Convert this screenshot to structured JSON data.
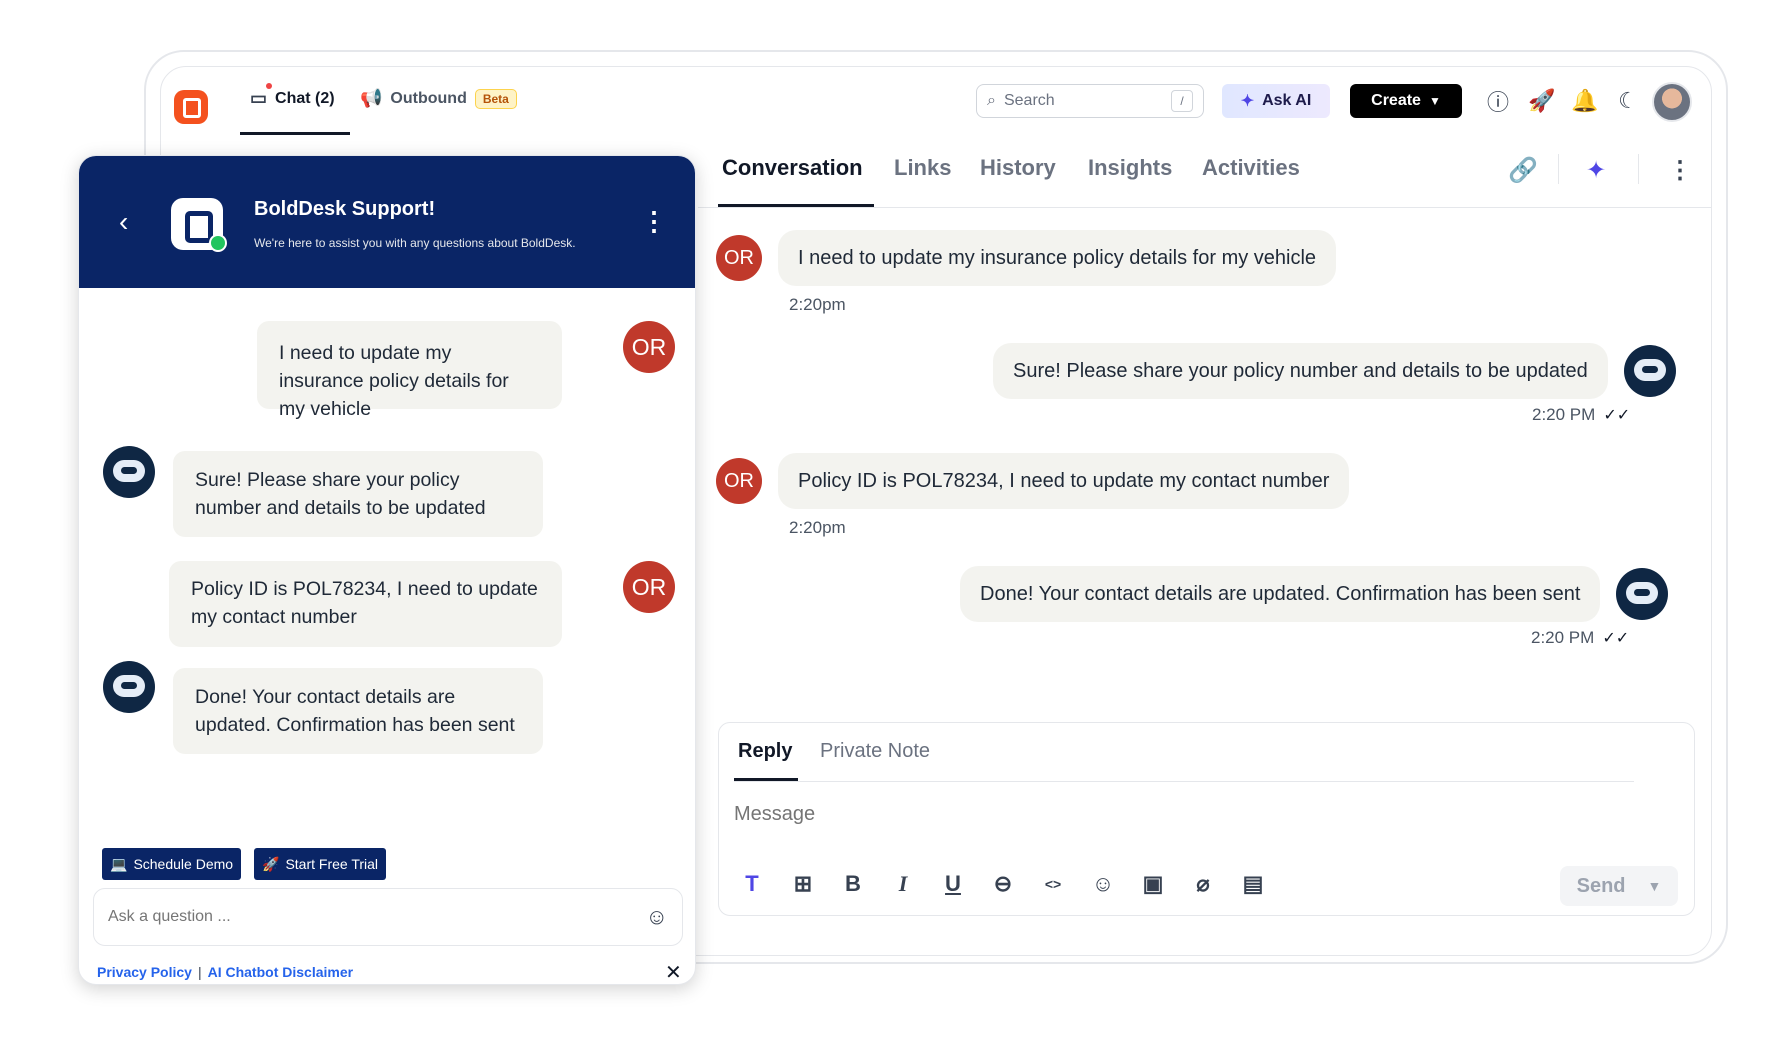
{
  "topbar": {
    "chat_tab": "Chat (2)",
    "outbound_tab": "Outbound",
    "beta_badge": "Beta",
    "search_placeholder": "Search",
    "search_shortcut": "/",
    "ask_ai": "Ask AI",
    "create": "Create"
  },
  "conversation": {
    "tabs": [
      "Conversation",
      "Links",
      "History",
      "Insights",
      "Activities"
    ],
    "messages": [
      {
        "from": "OR",
        "text": "I need to update my insurance policy details for my vehicle",
        "time": "2:20pm"
      },
      {
        "from": "bot",
        "text": "Sure! Please share your policy number and details to be updated",
        "time": "2:20 PM"
      },
      {
        "from": "OR",
        "text": "Policy ID is POL78234, I need to update my contact number",
        "time": "2:20pm"
      },
      {
        "from": "bot",
        "text": "Done! Your contact details are updated. Confirmation has been sent",
        "time": "2:20 PM"
      }
    ]
  },
  "reply": {
    "tab_reply": "Reply",
    "tab_private": "Private Note",
    "placeholder": "Message",
    "send": "Send"
  },
  "widget": {
    "title": "BoldDesk Support!",
    "subtitle": "We're here to assist you with any questions about BoldDesk.",
    "avatar_label": "OR",
    "messages": [
      {
        "from": "OR",
        "text": "I need to update my insurance policy details for my vehicle"
      },
      {
        "from": "bot",
        "text": "Sure! Please share your policy number and details to be updated"
      },
      {
        "from": "OR",
        "text": "Policy ID is POL78234, I need to update my contact number"
      },
      {
        "from": "bot",
        "text": "Done! Your contact details are updated. Confirmation has been sent"
      }
    ],
    "schedule_demo": "Schedule Demo",
    "start_trial": "Start Free Trial",
    "input_placeholder": "Ask a question ...",
    "privacy_policy": "Privacy Policy",
    "separator": "|",
    "disclaimer": "AI Chatbot Disclaimer"
  },
  "colors": {
    "brand_navy": "#0a2566",
    "logo_orange": "#f4511e",
    "customer_avatar": "#c0392b"
  }
}
